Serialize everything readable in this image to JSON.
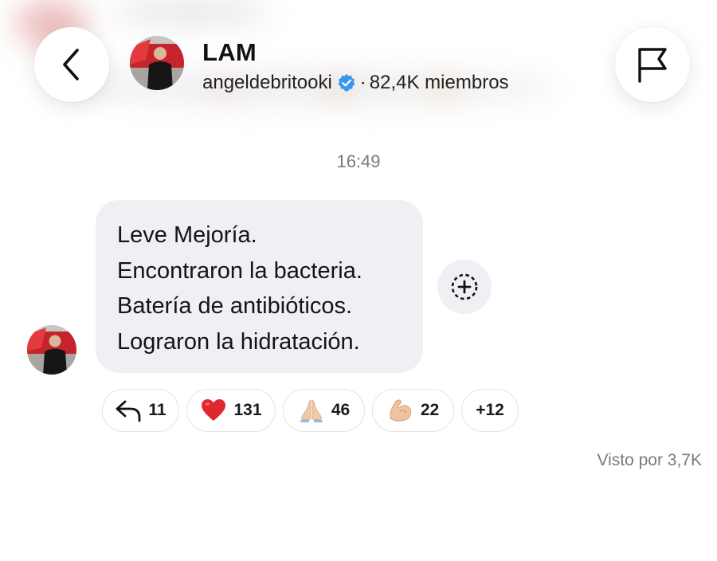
{
  "header": {
    "title": "LAM",
    "handle": "angeldebritooki",
    "separator": "·",
    "members": "82,4K miembros",
    "back_icon": "chevron-left-icon",
    "flag_icon": "flag-icon",
    "verified_icon": "verified-badge-icon",
    "verified_color": "#3797f0"
  },
  "message": {
    "time": "16:49",
    "lines": [
      "Leve Mejoría.",
      "Encontraron la bacteria.",
      "Batería de antibióticos.",
      "Lograron la hidratación."
    ],
    "add_reaction_icon": "add-reaction-icon"
  },
  "reactions": {
    "replies": {
      "icon": "reply-arrow-icon",
      "count": "11"
    },
    "heart": {
      "emoji": "❤️",
      "count": "131"
    },
    "pray": {
      "emoji": "🙏🏼",
      "count": "46"
    },
    "muscle": {
      "emoji": "💪🏼",
      "count": "22"
    },
    "more": {
      "label": "+12"
    }
  },
  "footer": {
    "seen": "Visto por 3,7K"
  },
  "colors": {
    "bubble": "#eef0f3",
    "muted_text": "#7a7a7f",
    "heart": "#e0262e"
  }
}
